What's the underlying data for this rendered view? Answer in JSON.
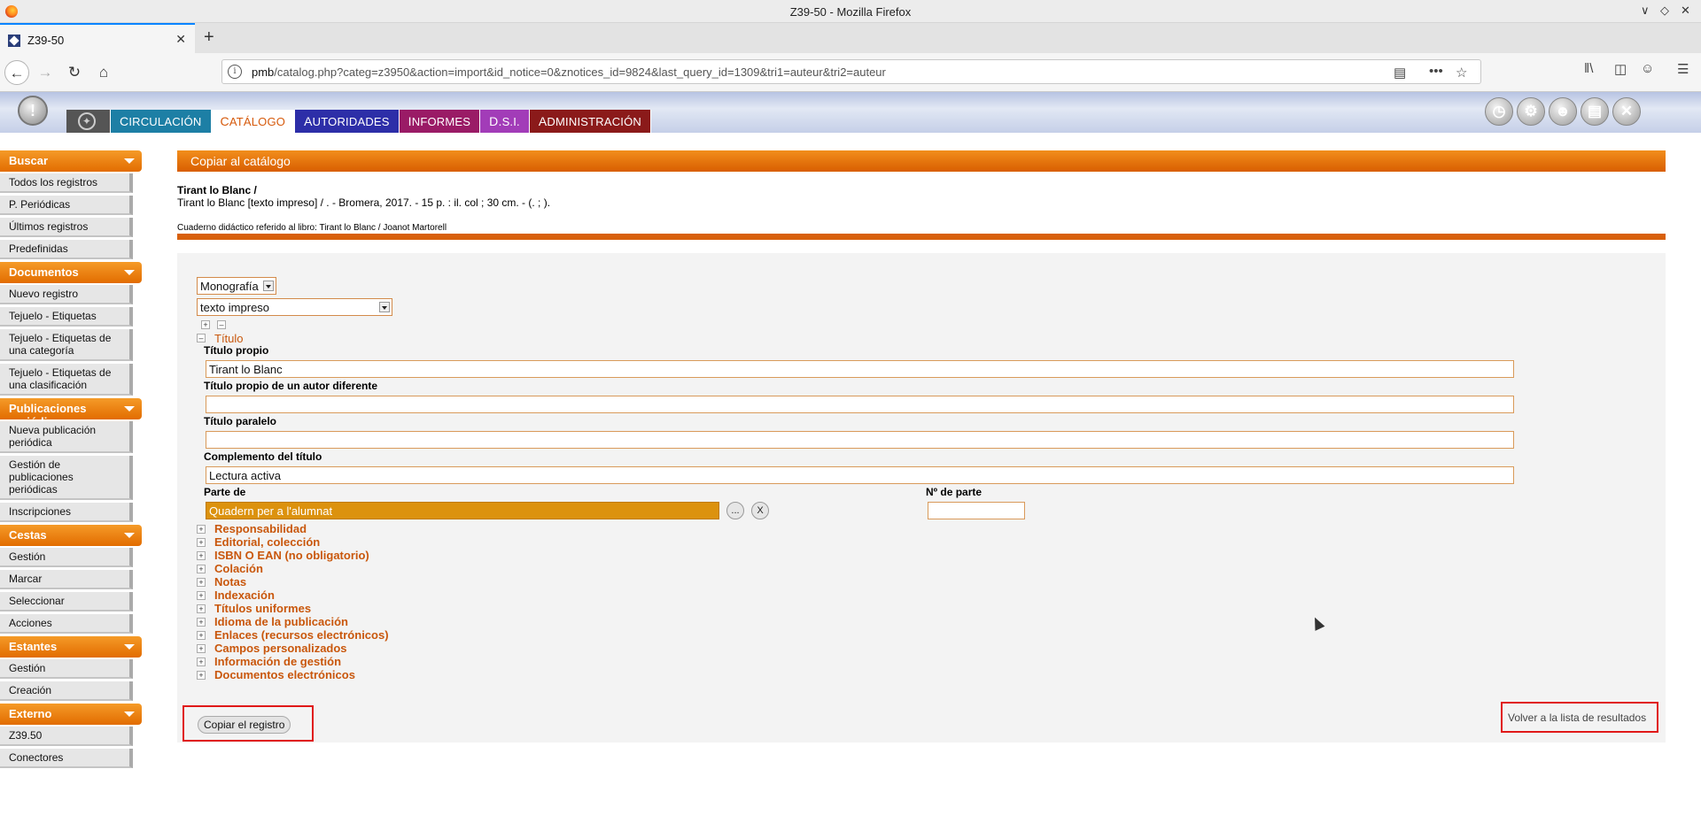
{
  "window": {
    "title": "Z39-50 - Mozilla Firefox",
    "controls": [
      "chevron-down",
      "restore",
      "close"
    ]
  },
  "tab": {
    "title": "Z39-50",
    "close": "✕",
    "new_tab": "+"
  },
  "browser": {
    "url_host": "pmb",
    "url_path": "/catalog.php?categ=z3950&action=import&id_notice=0&znotices_id=9824&last_query_id=1309&tri1=auteur&tri2=auteur",
    "more": "•••"
  },
  "pmb_menu": {
    "circulacion": "Circulación",
    "catalogo": "Catálogo",
    "autoridades": "Autoridades",
    "informes": "Informes",
    "dsi": "D.S.I.",
    "administracion": "Administración"
  },
  "sidebar": {
    "sections": [
      {
        "title": "Buscar",
        "items": [
          "Todos los registros",
          "P. Periódicas",
          "Últimos registros",
          "Predefinidas"
        ]
      },
      {
        "title": "Documentos",
        "items": [
          "Nuevo registro",
          "Tejuelo - Etiquetas",
          "Tejuelo - Etiquetas de una categoría",
          "Tejuelo - Etiquetas de una clasificación"
        ]
      },
      {
        "title": "Publicaciones periódicas",
        "items": [
          "Nueva publicación periódica",
          "Gestión de publicaciones periódicas",
          "Inscripciones"
        ]
      },
      {
        "title": "Cestas",
        "items": [
          "Gestión",
          "Marcar",
          "Seleccionar",
          "Acciones"
        ]
      },
      {
        "title": "Estantes",
        "items": [
          "Gestión",
          "Creación"
        ]
      },
      {
        "title": "Externo",
        "items": [
          "Z39.50",
          "Conectores"
        ]
      }
    ]
  },
  "main": {
    "header": "Copiar al catálogo",
    "record_title": "Tirant lo Blanc /",
    "record_desc": "Tirant lo Blanc [texto impreso] / . - Bromera, 2017. - 15 p. : il. col ; 30 cm. - (. ; ).",
    "record_note": "Cuaderno didáctico referido al libro: Tirant lo Blanc / Joanot Martorell",
    "doc_type": "Monografía",
    "support_type": "texto impreso",
    "titulo_section": "Título",
    "fields": {
      "titulo_propio_label": "Título propio",
      "titulo_propio_value": "Tirant lo Blanc",
      "titulo_autor_label": "Título propio de un autor diferente",
      "titulo_autor_value": "",
      "titulo_paralelo_label": "Título paralelo",
      "titulo_paralelo_value": "",
      "complemento_label": "Complemento del título",
      "complemento_value": "Lectura activa",
      "parte_de_label": "Parte de",
      "parte_de_value": "Quadern per a l'alumnat",
      "n_parte_label": "Nº de parte",
      "n_parte_value": "",
      "dots_button": "...",
      "clear_button": "X"
    },
    "sections": [
      "Responsabilidad",
      "Editorial, colección",
      "ISBN O EAN (no obligatorio)",
      "Colación",
      "Notas",
      "Indexación",
      "Títulos uniformes",
      "Idioma de la publicación",
      "Enlaces (recursos electrónicos)",
      "Campos personalizados",
      "Información de gestión",
      "Documentos electrónicos"
    ],
    "copy_button": "Copiar el registro",
    "back_link": "Volver a la lista de resultados"
  },
  "colors": {
    "accent_orange": "#e26c00",
    "highlight_red": "#e01818"
  }
}
